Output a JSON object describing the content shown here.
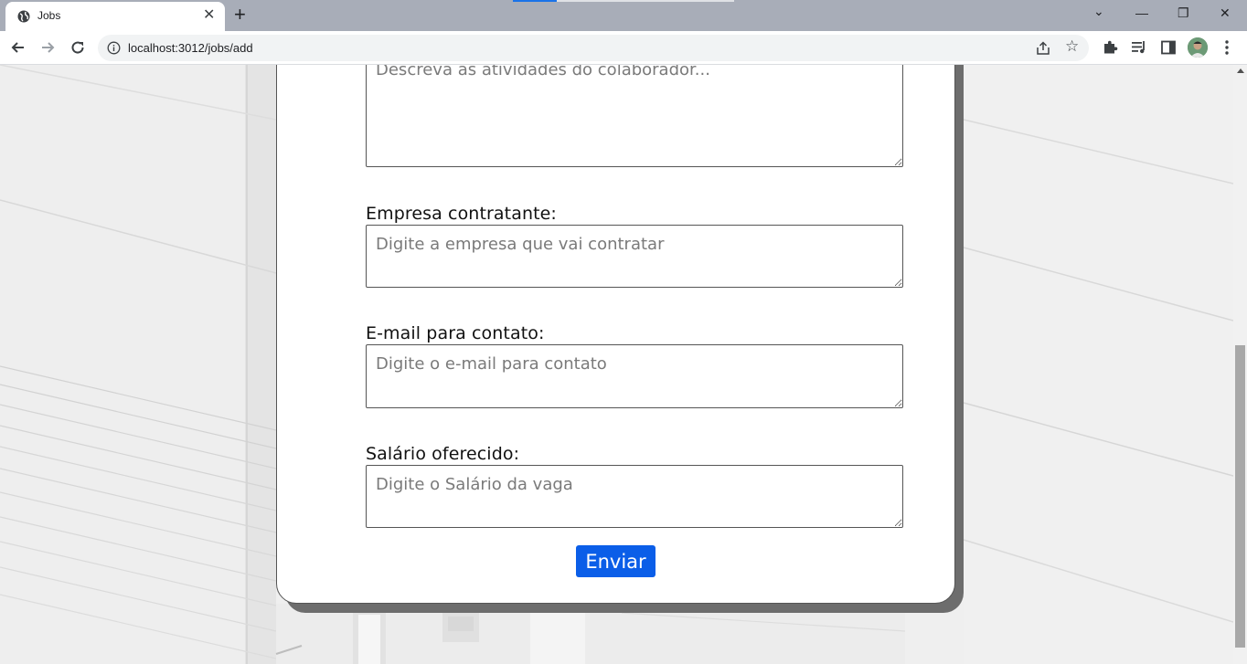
{
  "browser": {
    "tab_title": "Jobs",
    "tab_close": "✕",
    "new_tab": "+",
    "url": "localhost:3012/jobs/add",
    "window_controls": {
      "dropdown": "⌄",
      "minimize": "—",
      "restore": "❐",
      "close": "✕"
    },
    "icons": [
      "back-arrow-icon",
      "forward-arrow-icon",
      "reload-icon",
      "info-icon",
      "share-icon",
      "star-icon",
      "extensions-puzzle-icon",
      "media-queue-icon",
      "side-panel-icon",
      "profile-avatar",
      "kebab-menu-icon"
    ]
  },
  "form": {
    "description_placeholder": "Descreva as atividades do colaborador...",
    "company": {
      "label": "Empresa contratante:",
      "placeholder": "Digite a empresa que vai contratar"
    },
    "email": {
      "label": "E-mail para contato:",
      "placeholder": "Digite o e-mail para contato"
    },
    "salary": {
      "label": "Salário oferecido:",
      "placeholder": "Digite o Salário da vaga"
    },
    "submit_label": "Enviar"
  },
  "colors": {
    "accent": "#0b5ee8",
    "tabbar": "#a8adb8",
    "card_shadow": "#6d6d6d"
  }
}
